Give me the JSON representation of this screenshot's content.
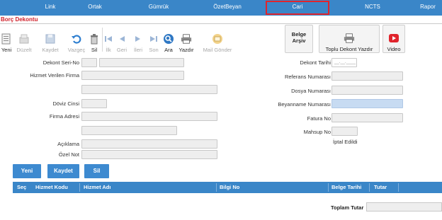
{
  "nav": {
    "tabs": [
      {
        "label": "Link",
        "active": false
      },
      {
        "label": "Ortak",
        "active": false
      },
      {
        "label": "Gümrük",
        "active": false
      },
      {
        "label": "ÖzetBeyan",
        "active": false
      },
      {
        "label": "Cari",
        "active": true
      },
      {
        "label": "NCTS",
        "active": false
      },
      {
        "label": "Rapor",
        "active": false
      }
    ]
  },
  "page": {
    "title": "Borç Dekontu"
  },
  "toolbar": {
    "yeni": "Yeni",
    "duzelt": "Düzelt",
    "kaydet": "Kaydet",
    "vazgec": "Vazgeç",
    "sil": "Sil",
    "ilk": "İlk",
    "geri": "Geri",
    "ileri": "İleri",
    "son": "Son",
    "ara": "Ara",
    "yazdir": "Yazdır",
    "mail_gonder": "Mail Gönder",
    "belge_arsiv_1": "Belge",
    "belge_arsiv_2": "Arşiv",
    "toplu_dekont_yazdir": "Toplu Dekont Yazdır",
    "video": "Video"
  },
  "form": {
    "dekont_seri_no": {
      "label": "Dekont Seri-No",
      "value": ""
    },
    "hizmet_veren_firma": {
      "label": "Hizmet Verilen Firma",
      "value": ""
    },
    "doviz_cinsi": {
      "label": "Döviz Cinsi",
      "value": ""
    },
    "firma_adresi": {
      "label": "Firma Adresi",
      "value": ""
    },
    "aciklama": {
      "label": "Açıklama",
      "value": ""
    },
    "ozel_not": {
      "label": "Özel Not",
      "value": ""
    },
    "dekont_tarihi": {
      "label": "Dekont Tarihi",
      "value": "__.__.____"
    },
    "referans_numarasi": {
      "label": "Referans Numarası",
      "value": ""
    },
    "dosya_numarasi": {
      "label": "Dosya Numarası",
      "value": ""
    },
    "beyanname_numarasi": {
      "label": "Beyanname Numarası",
      "value": ""
    },
    "fatura_no": {
      "label": "Fatura No",
      "value": ""
    },
    "mahsup_no": {
      "label": "Mahsup No",
      "value": ""
    },
    "iptal_status": "İptal Edildi"
  },
  "actions": {
    "yeni": "Yeni",
    "kaydet": "Kaydet",
    "sil": "Sil"
  },
  "grid": {
    "columns": [
      "Seç",
      "Hizmet Kodu",
      "Hizmet Adı",
      "Bilgi No",
      "Belge Tarihi",
      "Tutar"
    ]
  },
  "totals": {
    "label": "Toplam Tutar",
    "value": ""
  },
  "colors": {
    "accent": "#3a86c8",
    "title_red": "#d0202a",
    "highlight": "#c7dbf2"
  }
}
